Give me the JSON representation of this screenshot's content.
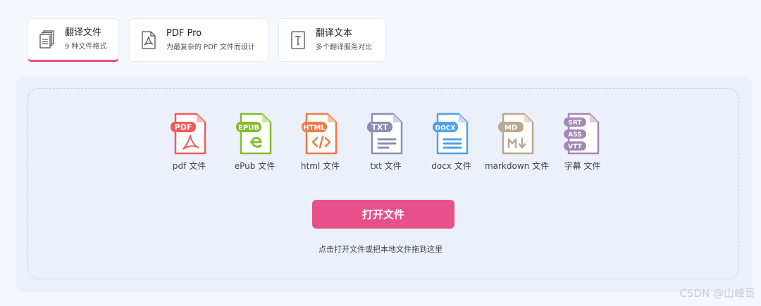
{
  "tabs": [
    {
      "title": "翻译文件",
      "subtitle": "9 种文件格式",
      "icon": "documents-icon",
      "active": true
    },
    {
      "title": "PDF Pro",
      "subtitle": "为最复杂的 PDF 文件而设计",
      "icon": "pdf-icon",
      "active": false
    },
    {
      "title": "翻译文本",
      "subtitle": "多个翻译服务对比",
      "icon": "text-icon",
      "active": false
    }
  ],
  "formats": [
    {
      "label": "pdf 文件",
      "badge": "PDF",
      "color": "#f05a5a"
    },
    {
      "label": "ePub 文件",
      "badge": "EPUB",
      "color": "#84bb2f"
    },
    {
      "label": "html 文件",
      "badge": "HTML",
      "color": "#f07a45"
    },
    {
      "label": "txt 文件",
      "badge": "TXT",
      "color": "#8a8fb2"
    },
    {
      "label": "docx 文件",
      "badge": "DOCX",
      "color": "#4fa3ea"
    },
    {
      "label": "markdown 文件",
      "badge": "MD",
      "color": "#b8a88e"
    },
    {
      "label": "字幕 文件",
      "badges": [
        "SRT",
        "ASS",
        "VTT"
      ],
      "color": "#a288b6"
    }
  ],
  "open_button": "打开文件",
  "hint": "点击打开文件或把本地文件拖到这里",
  "watermark": "CSDN @山峰哥",
  "colors": {
    "accent": "#e8508a",
    "panel": "#ebf0fa",
    "background": "#f4f7fc"
  }
}
